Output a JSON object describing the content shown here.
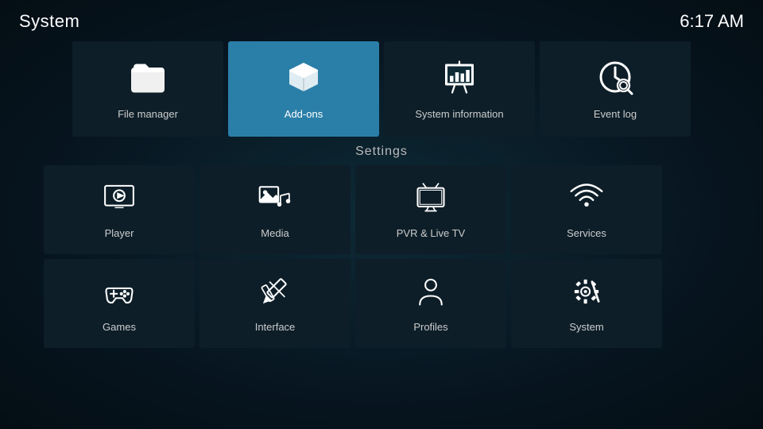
{
  "header": {
    "title": "System",
    "clock": "6:17 AM"
  },
  "top_items": [
    {
      "id": "file-manager",
      "label": "File manager",
      "active": false
    },
    {
      "id": "add-ons",
      "label": "Add-ons",
      "active": true
    },
    {
      "id": "system-information",
      "label": "System information",
      "active": false
    },
    {
      "id": "event-log",
      "label": "Event log",
      "active": false
    }
  ],
  "settings_label": "Settings",
  "grid_row1": [
    {
      "id": "player",
      "label": "Player"
    },
    {
      "id": "media",
      "label": "Media"
    },
    {
      "id": "pvr-live-tv",
      "label": "PVR & Live TV"
    },
    {
      "id": "services",
      "label": "Services"
    }
  ],
  "grid_row2": [
    {
      "id": "games",
      "label": "Games"
    },
    {
      "id": "interface",
      "label": "Interface"
    },
    {
      "id": "profiles",
      "label": "Profiles"
    },
    {
      "id": "system",
      "label": "System"
    }
  ]
}
